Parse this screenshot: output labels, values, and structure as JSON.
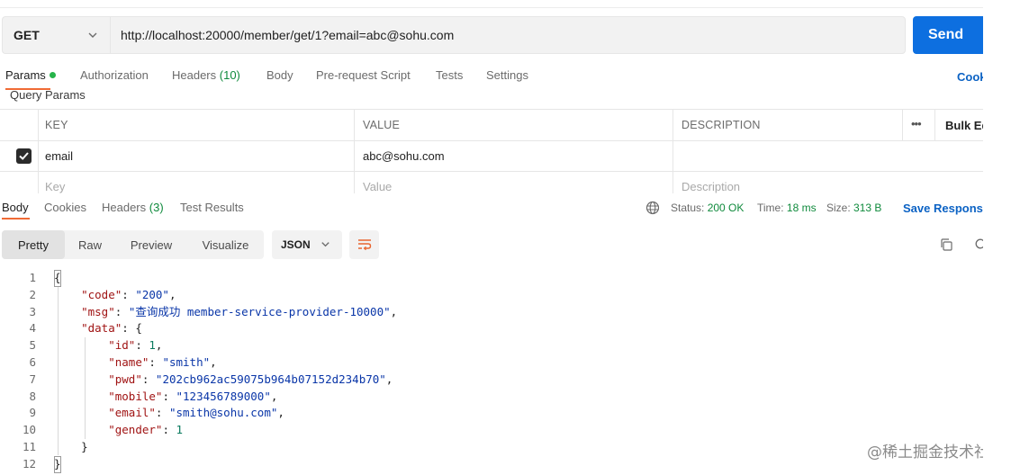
{
  "request": {
    "method": "GET",
    "url": "http://localhost:20000/member/get/1?email=abc@sohu.com",
    "send_label": "Send",
    "tabs": [
      {
        "label": "Params",
        "count": ""
      },
      {
        "label": "Authorization",
        "count": ""
      },
      {
        "label": "Headers",
        "count": "(10)"
      },
      {
        "label": "Body",
        "count": ""
      },
      {
        "label": "Pre-request Script",
        "count": ""
      },
      {
        "label": "Tests",
        "count": ""
      },
      {
        "label": "Settings",
        "count": ""
      }
    ],
    "cookies_label": "Cook",
    "query_params_label": "Query Params"
  },
  "params_table": {
    "headers": {
      "key": "KEY",
      "value": "VALUE",
      "description": "DESCRIPTION",
      "more": "•••",
      "bulk_edit": "Bulk Ed"
    },
    "rows": [
      {
        "key": "email",
        "value": "abc@sohu.com",
        "description": "",
        "checked": true
      }
    ],
    "placeholder": {
      "key": "Key",
      "value": "Value",
      "description": "Description"
    }
  },
  "response": {
    "tabs": [
      {
        "label": "Body",
        "count": ""
      },
      {
        "label": "Cookies",
        "count": ""
      },
      {
        "label": "Headers",
        "count": "(3)"
      },
      {
        "label": "Test Results",
        "count": ""
      }
    ],
    "status_label": "Status:",
    "status_value": "200 OK",
    "time_label": "Time:",
    "time_value": "18 ms",
    "size_label": "Size:",
    "size_value": "313 B",
    "save_label": "Save Response",
    "view_modes": [
      "Pretty",
      "Raw",
      "Preview",
      "Visualize"
    ],
    "format": "JSON"
  },
  "body_lines": [
    {
      "n": "1",
      "t": "{"
    },
    {
      "n": "2",
      "t": "    \"code\": \"200\","
    },
    {
      "n": "3",
      "t": "    \"msg\": \"查询成功 member-service-provider-10000\","
    },
    {
      "n": "4",
      "t": "    \"data\": {"
    },
    {
      "n": "5",
      "t": "        \"id\": 1,"
    },
    {
      "n": "6",
      "t": "        \"name\": \"smith\","
    },
    {
      "n": "7",
      "t": "        \"pwd\": \"202cb962ac59075b964b07152d234b70\","
    },
    {
      "n": "8",
      "t": "        \"mobile\": \"123456789000\","
    },
    {
      "n": "9",
      "t": "        \"email\": \"smith@sohu.com\","
    },
    {
      "n": "10",
      "t": "        \"gender\": 1"
    },
    {
      "n": "11",
      "t": "    }"
    },
    {
      "n": "12",
      "t": "}"
    }
  ],
  "watermark": "@稀土掘金技术社区",
  "colors": {
    "send": "#0d6fe0",
    "accent": "#f06a35",
    "link": "#0b62c4",
    "status_green": "#0f8a3c"
  }
}
